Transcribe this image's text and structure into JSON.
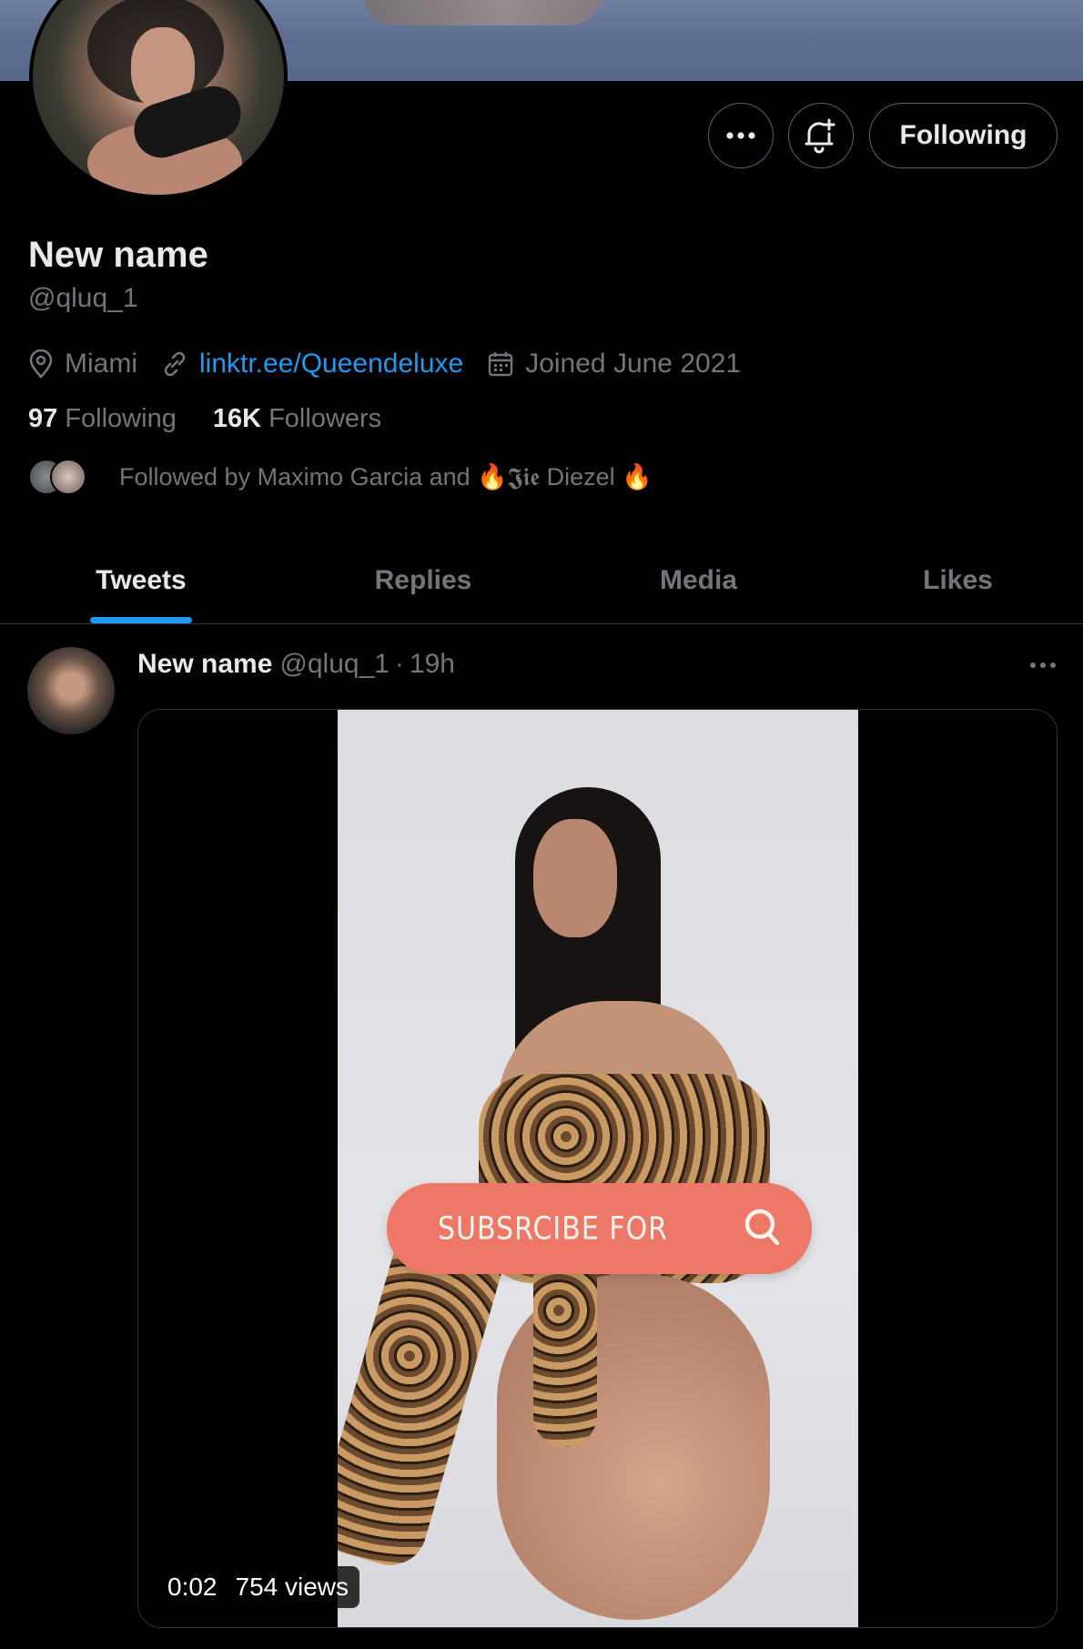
{
  "profile": {
    "name": "New name",
    "handle": "@qluq_1",
    "location": "Miami",
    "link": "linktr.ee/Queendeluxe",
    "joined": "Joined June 2021",
    "following_count": "97",
    "following_label": "Following",
    "followers_count": "16K",
    "followers_label": "Followers",
    "followed_by": "Followed by Maximo Garcia and 🔥𝕵𝖎𝖊 Diezel 🔥"
  },
  "actions": {
    "following_button": "Following",
    "more_icon": "more-horizontal-icon",
    "notify_icon": "bell-plus-icon"
  },
  "tabs": [
    {
      "label": "Tweets",
      "active": true
    },
    {
      "label": "Replies",
      "active": false
    },
    {
      "label": "Media",
      "active": false
    },
    {
      "label": "Likes",
      "active": false
    }
  ],
  "tweet": {
    "name": "New name",
    "handle": "@qluq_1",
    "separator": "·",
    "time": "19h",
    "video": {
      "overlay_text": "SUBSRCIBE FOR",
      "duration": "0:02",
      "views": "754 views"
    }
  },
  "colors": {
    "background": "#000000",
    "accent": "#1d9bf0",
    "muted": "#71767b",
    "text": "#e7e9ea",
    "border": "#2f3336",
    "overlay": "#ee7868"
  }
}
